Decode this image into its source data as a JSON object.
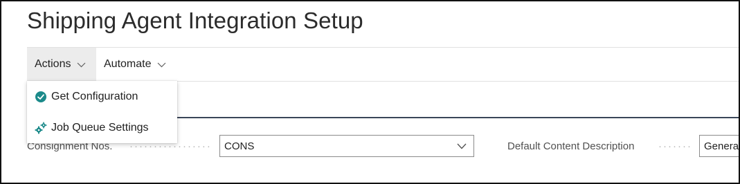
{
  "page": {
    "title": "Shipping Agent Integration Setup"
  },
  "action_bar": {
    "actions_label": "Actions",
    "automate_label": "Automate"
  },
  "actions_menu": {
    "items": [
      {
        "label": "Get Configuration",
        "icon": "check-circle-icon"
      },
      {
        "label": "Job Queue Settings",
        "icon": "gears-icon"
      }
    ]
  },
  "fields": {
    "consignment_nos": {
      "label": "Consignment Nos.",
      "value": "CONS"
    },
    "default_content_description": {
      "label": "Default Content Description",
      "value": "Genera"
    }
  },
  "colors": {
    "accent_teal": "#1b8a8a",
    "divider": "#3a4658",
    "actions_bg": "#ececec"
  }
}
